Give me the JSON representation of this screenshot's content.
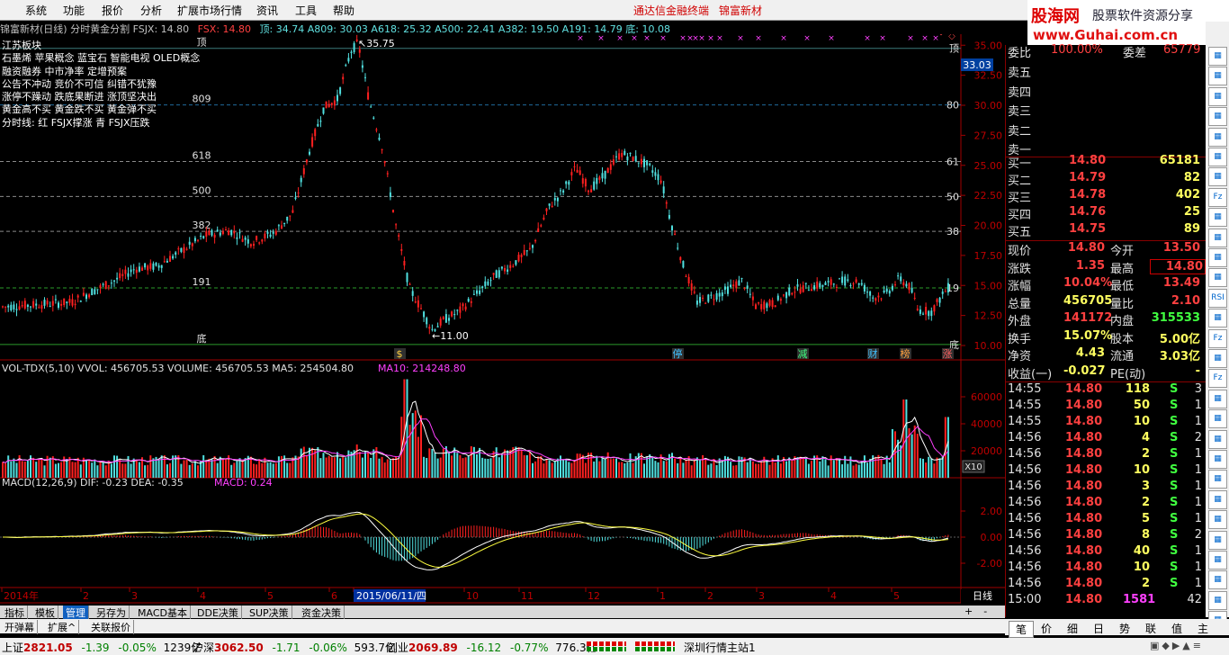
{
  "menu": {
    "items": [
      "系统",
      "功能",
      "报价",
      "分析",
      "扩展市场行情",
      "资讯",
      "工具",
      "帮助"
    ],
    "center_links": [
      "通达信金融终端",
      "锦富新材"
    ]
  },
  "logo": {
    "brand": "股海网",
    "slogan": "股票软件资源分享",
    "url_text": "www.Guhai.com.cn"
  },
  "chart_header": {
    "title": "锦富新材(日线) 分时黄金分割 FSJX: 14.80",
    "fsx": "FSX: 14.80",
    "rest": "顶: 34.74 A809: 30.03 A618: 25.32 A500: 22.41 A382: 19.50 A191: 14.79 底: 10.08"
  },
  "legend_lines": [
    "江苏板块",
    "石墨烯 苹果概念 蓝宝石 智能电视 OLED概念",
    "融资融券 中市净率 定增预案",
    "公告不冲动 竞价不可信 纠错不犹豫",
    "涨停不躁动 跌底果断进 涨顶坚决出",
    "黄金高不买 黄金跌不买 黄金弹不买",
    "分时线: 红 FSJX撑涨 青 FSJX压跌"
  ],
  "price_chart": {
    "y_ticks": [
      "35.00",
      "32.50",
      "30.00",
      "27.50",
      "25.00",
      "22.50",
      "20.00",
      "17.50",
      "15.00",
      "12.50",
      "10.00"
    ],
    "y_values": [
      35,
      32.5,
      30,
      27.5,
      25,
      22.5,
      20,
      17.5,
      15,
      12.5,
      10
    ],
    "gold_lines": [
      {
        "label": "顶",
        "rlabel": "顶",
        "value": 34.74,
        "color": "#3a7a7a"
      },
      {
        "label": "809",
        "rlabel": "80",
        "value": 30.03,
        "color": "#1f6a9a"
      },
      {
        "label": "618",
        "rlabel": "61",
        "value": 25.32,
        "color": "#8a8a8a"
      },
      {
        "label": "500",
        "rlabel": "50",
        "value": 22.41,
        "color": "#8a8a8a"
      },
      {
        "label": "382",
        "rlabel": "38",
        "value": 19.5,
        "color": "#8a8a8a"
      },
      {
        "label": "191",
        "rlabel": "19",
        "value": 14.79,
        "color": "#2a9a2a"
      },
      {
        "label": "底",
        "rlabel": "底",
        "value": 10.08,
        "color": "#2a9a2a"
      }
    ],
    "high_label": "35.75",
    "low_label": "11.00",
    "current_price_tag": "33.03",
    "markers": [
      "停",
      "减",
      "财",
      "榜",
      "涨"
    ],
    "s_marker": "$"
  },
  "volume": {
    "header": "VOL-TDX(5,10) VVOL: 456705.53 VOLUME: 456705.53 MA5: 254504.80",
    "ma10": "MA10: 214248.80",
    "y_ticks": [
      "60000",
      "40000",
      "20000"
    ],
    "scale": "X10"
  },
  "macd": {
    "header": "MACD(12,26,9) DIF: -0.23 DEA: -0.35",
    "macd": "MACD: 0.24",
    "y_ticks": [
      "2.00",
      "0.00",
      "-2.00"
    ]
  },
  "time_axis": {
    "labels": [
      "2014年",
      "2",
      "3",
      "4",
      "5",
      "6",
      "2015/06/11/四",
      "10",
      "11",
      "12",
      "1",
      "2",
      "3",
      "4",
      "5"
    ],
    "period": "日线"
  },
  "bottom_tabs": [
    "指标",
    "模板",
    "管理",
    "另存为",
    "MACD基本",
    "DDE决策",
    "SUP决策",
    "资金决策"
  ],
  "bottom_tabs2": [
    "开弹幕",
    "扩展^",
    "关联报价"
  ],
  "right_panel": {
    "committee": {
      "label": "委比",
      "value": "100.00%",
      "label2": "委差",
      "value2": "65779"
    },
    "sell": [
      {
        "label": "卖五"
      },
      {
        "label": "卖四"
      },
      {
        "label": "卖三"
      },
      {
        "label": "卖二"
      },
      {
        "label": "卖一"
      }
    ],
    "buy": [
      {
        "label": "买一",
        "price": "14.80",
        "vol": "65181"
      },
      {
        "label": "买二",
        "price": "14.79",
        "vol": "82"
      },
      {
        "label": "买三",
        "price": "14.78",
        "vol": "402"
      },
      {
        "label": "买四",
        "price": "14.76",
        "vol": "25"
      },
      {
        "label": "买五",
        "price": "14.75",
        "vol": "89"
      }
    ],
    "stats": [
      {
        "l1": "现价",
        "v1": "14.80",
        "l2": "今开",
        "v2": "13.50"
      },
      {
        "l1": "涨跌",
        "v1": "1.35",
        "l2": "最高",
        "v2": "14.80"
      },
      {
        "l1": "涨幅",
        "v1": "10.04%",
        "l2": "最低",
        "v2": "13.49"
      },
      {
        "l1": "总量",
        "v1": "456705",
        "l2": "量比",
        "v2": "2.10"
      },
      {
        "l1": "外盘",
        "v1": "141172",
        "l2": "内盘",
        "v2": "315533"
      },
      {
        "l1": "换手",
        "v1": "15.07%",
        "l2": "股本",
        "v2": "5.00亿"
      },
      {
        "l1": "净资",
        "v1": "4.43",
        "l2": "流通",
        "v2": "3.03亿"
      },
      {
        "l1": "收益(一)",
        "v1": "-0.027",
        "l2": "PE(动)",
        "v2": "-"
      }
    ],
    "ticks": [
      {
        "t": "14:55",
        "p": "14.80",
        "v": "118",
        "s": "S",
        "n": "3"
      },
      {
        "t": "14:55",
        "p": "14.80",
        "v": "50",
        "s": "S",
        "n": "1"
      },
      {
        "t": "14:55",
        "p": "14.80",
        "v": "10",
        "s": "S",
        "n": "1"
      },
      {
        "t": "14:56",
        "p": "14.80",
        "v": "4",
        "s": "S",
        "n": "2"
      },
      {
        "t": "14:56",
        "p": "14.80",
        "v": "2",
        "s": "S",
        "n": "1"
      },
      {
        "t": "14:56",
        "p": "14.80",
        "v": "10",
        "s": "S",
        "n": "1"
      },
      {
        "t": "14:56",
        "p": "14.80",
        "v": "3",
        "s": "S",
        "n": "1"
      },
      {
        "t": "14:56",
        "p": "14.80",
        "v": "2",
        "s": "S",
        "n": "1"
      },
      {
        "t": "14:56",
        "p": "14.80",
        "v": "5",
        "s": "S",
        "n": "1"
      },
      {
        "t": "14:56",
        "p": "14.80",
        "v": "8",
        "s": "S",
        "n": "2"
      },
      {
        "t": "14:56",
        "p": "14.80",
        "v": "40",
        "s": "S",
        "n": "1"
      },
      {
        "t": "14:56",
        "p": "14.80",
        "v": "10",
        "s": "S",
        "n": "1"
      },
      {
        "t": "14:56",
        "p": "14.80",
        "v": "2",
        "s": "S",
        "n": "1"
      },
      {
        "t": "15:00",
        "p": "14.80",
        "v": "1581",
        "s": "",
        "n": "42"
      }
    ],
    "tabs": [
      "笔",
      "价",
      "细",
      "日",
      "势",
      "联",
      "值",
      "主"
    ]
  },
  "right_toolbar": [
    "RSI",
    "Fz",
    "Fz",
    "Fz"
  ],
  "status": {
    "sh": {
      "name": "上证",
      "val": "2821.05",
      "chg": "-1.39",
      "pct": "-0.05%",
      "amt": "1239亿"
    },
    "sz": {
      "name": "沪深",
      "val": "3062.50",
      "chg": "-1.71",
      "pct": "-0.06%",
      "amt": "593.7亿"
    },
    "cy": {
      "name": "创业",
      "val": "2069.89",
      "chg": "-16.12",
      "pct": "-0.77%",
      "amt": "776.3亿"
    },
    "site": "深圳行情主站1"
  },
  "colors": {
    "up": "#ff3030",
    "down": "#50e0e0",
    "yellow": "#ffff40",
    "gold": "#ffd040",
    "purple": "#ff40ff"
  }
}
